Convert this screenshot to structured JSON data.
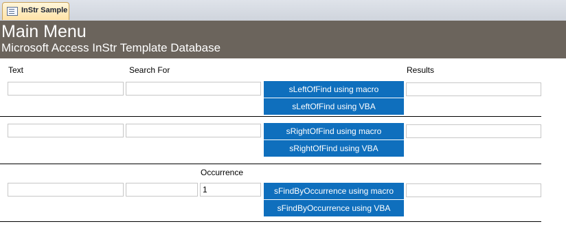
{
  "tab": {
    "label": "InStr Sample",
    "icon": "form-icon"
  },
  "header": {
    "title": "Main Menu",
    "subtitle": "Microsoft Access InStr Template Database"
  },
  "columns": {
    "text": "Text",
    "search_for": "Search For",
    "results": "Results",
    "occurrence": "Occurrence"
  },
  "left_section": {
    "macro_button": "sLeftOfFind using macro",
    "vba_button": "sLeftOfFind using VBA",
    "text_value": "",
    "search_value": "",
    "result_value": ""
  },
  "right_section": {
    "macro_button": "sRightOfFind using macro",
    "vba_button": "sRightOfFind using VBA",
    "text_value": "",
    "search_value": "",
    "result_value": ""
  },
  "occurrence_section": {
    "macro_button": "sFindByOccurrence using macro",
    "vba_button": "sFindByOccurrence using VBA",
    "text_value": "",
    "search_value": "",
    "occurrence_value": "1",
    "result_value": ""
  },
  "colors": {
    "header_bg": "#6b645c",
    "button_bg": "#0f6fbd",
    "tab_bg": "#ffe2a6"
  }
}
